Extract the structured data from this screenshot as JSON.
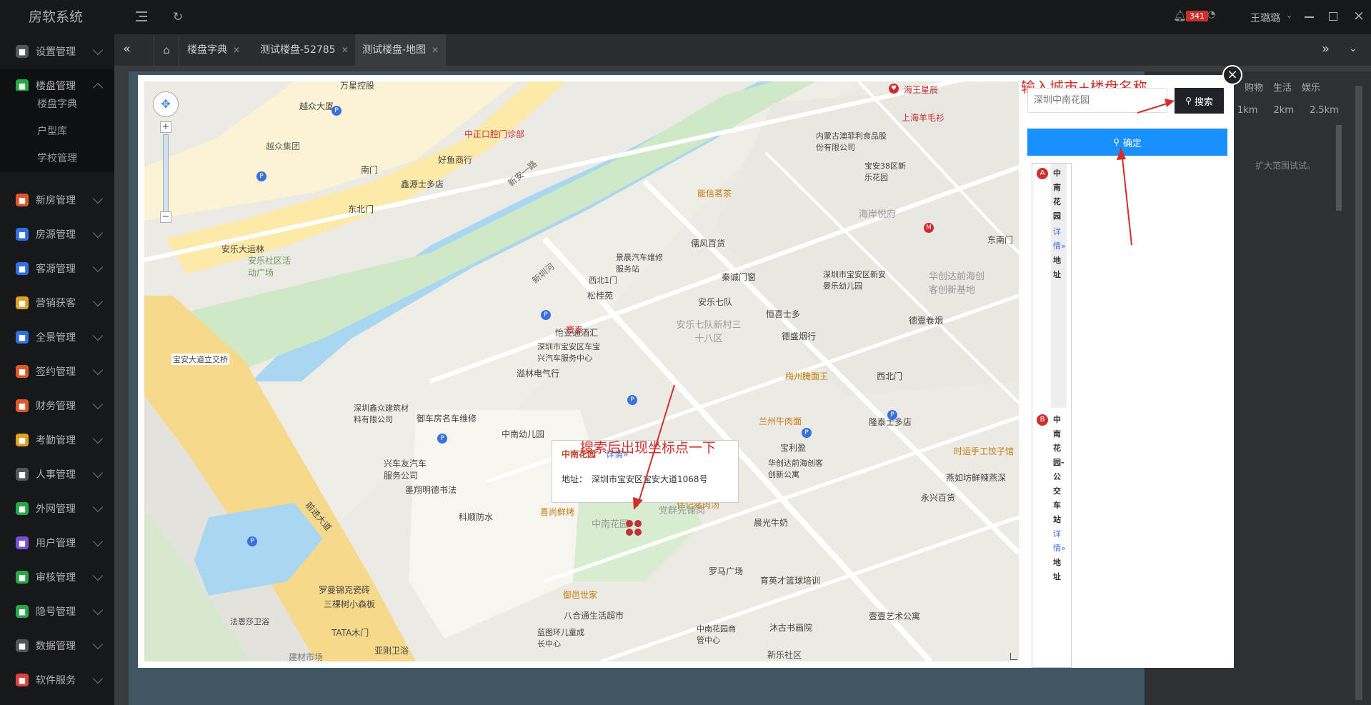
{
  "app": {
    "title": "房软系统"
  },
  "sidebar": {
    "items": [
      {
        "label": "设置管理",
        "color": "#555"
      },
      {
        "label": "楼盘管理",
        "color": "#27a844"
      },
      {
        "label": "新房管理",
        "color": "#e0572a"
      },
      {
        "label": "房源管理",
        "color": "#2f6fe0"
      },
      {
        "label": "客源管理",
        "color": "#2f6fe0"
      },
      {
        "label": "营销获客",
        "color": "#e0a020"
      },
      {
        "label": "全景管理",
        "color": "#2f6fe0"
      },
      {
        "label": "签约管理",
        "color": "#e0572a"
      },
      {
        "label": "财务管理",
        "color": "#e0572a"
      },
      {
        "label": "考勤管理",
        "color": "#e0a020"
      },
      {
        "label": "人事管理",
        "color": "#555"
      },
      {
        "label": "外网管理",
        "color": "#27a844"
      },
      {
        "label": "用户管理",
        "color": "#7a4fd0"
      },
      {
        "label": "审核管理",
        "color": "#27a844"
      },
      {
        "label": "隐号管理",
        "color": "#27a844"
      },
      {
        "label": "数据管理",
        "color": "#555"
      },
      {
        "label": "软件服务",
        "color": "#e04040"
      }
    ],
    "sub_items": [
      "楼盘字典",
      "户型库",
      "学校管理"
    ]
  },
  "header": {
    "notification_count": "341",
    "user_name": "王璐璐"
  },
  "tabs": [
    {
      "label": "楼盘字典"
    },
    {
      "label": "测试楼盘-52785"
    },
    {
      "label": "测试楼盘-地图"
    }
  ],
  "right_panel": {
    "categories": [
      "购物",
      "生活",
      "娱乐"
    ],
    "distances": [
      "1km",
      "2km",
      "2.5km"
    ],
    "hint": "扩大范围试试。"
  },
  "map": {
    "labels": {
      "l1": "万星控股",
      "l2": "越众大厦",
      "l3": "越众集团",
      "l4": "中正口腔门诊部",
      "l5": "好鱼商行",
      "l6": "南门",
      "l7": "鑫源士多店",
      "l8": "东北门",
      "l9": "新安一路",
      "l10": "安乐大运林",
      "l11": "安乐社区活动广场",
      "l12": "新圳河",
      "l13": "宝安大道立交桥",
      "l14": "深圳鑫众建筑材料有限公司",
      "l15": "御车房名车维修",
      "l16": "兴车友汽车服务公司",
      "l17": "前进大道",
      "l18": "罗曼锦克瓷砖",
      "l19": "三棵树小森板",
      "l20": "法恩莎卫浴",
      "l21": "TATA木门",
      "l22": "亚刚卫浴",
      "l23": "建材市场",
      "l24": "海王星辰",
      "l25": "上海羊毛衫",
      "l26": "内蒙古澳菲利食品股份有限公司",
      "l27": "宝安38区新乐花园",
      "l28": "能信茗茶",
      "l29": "海岸悦府",
      "l30": "东南门",
      "l31": "儒风百货",
      "l32": "景晨汽车维修服务站",
      "l33": "秦诚门窗",
      "l34": "西北1门",
      "l35": "松桂苑",
      "l36": "安乐七队",
      "l37": "恒喜士多",
      "l38": "安乐七队新村三十八区",
      "l39": "深圳市宝安区新安晏乐幼儿园",
      "l40": "华创达前海创客创新基地",
      "l41": "德壹卷烟",
      "l42": "怡亚通酒汇",
      "l43": "深圳市宝安区车宝兴汽车服务中心",
      "l44": "溢林电气行",
      "l45": "德盛烟行",
      "l46": "梅州腌面王",
      "l47": "西北门",
      "l48": "中南幼儿园",
      "l49": "兰州牛肉面",
      "l50": "隆泰士多店",
      "l51": "宝利盈",
      "l52": "时运手工饺子馆",
      "l53": "墨翔明德书法",
      "l54": "华创达前海创客创新公寓",
      "l55": "科顺防水",
      "l56": "喜尚鲜烤",
      "l57": "伟记猪肉汤",
      "l58": "晨光牛奶",
      "l59": "燕如坊鲜辣燕深",
      "l60": "永兴百货",
      "l61": "罗马广场",
      "l62": "育英才篮球培训",
      "l63": "御邑世家",
      "l64": "八合通生活超市",
      "l65": "壹壹艺术公寓",
      "l66": "沐古书画院",
      "l67": "中南花园商管中心",
      "l68": "新乐社区",
      "l69": "党群先锋岗",
      "l70": "中南花园",
      "l71": "寶泰",
      "l72": "蓝图环儿童成长中心"
    },
    "popup": {
      "title": "中南花园",
      "detail_link": "详情»",
      "address_label": "地址：",
      "address": "深圳市宝安区宝安大道1068号"
    },
    "annotation_bottom": "搜索后出现坐标点一下"
  },
  "search": {
    "annotation_top": "输入城市+楼盘名称",
    "placeholder": "深圳中南花园",
    "button_label": "搜索",
    "confirm_label": "确定"
  },
  "results": [
    {
      "marker": "A",
      "name": "中南花园",
      "detail": "详情»",
      "address_label": "地址"
    },
    {
      "marker": "B",
      "name": "中南花园-公交车站",
      "detail": "详情»",
      "address_label": "地址"
    }
  ]
}
